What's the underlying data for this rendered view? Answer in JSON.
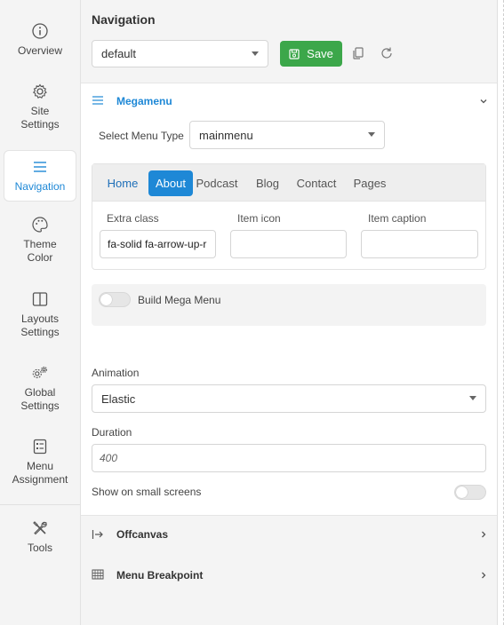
{
  "sidebar": {
    "items": [
      {
        "label": "Overview",
        "icon": "info-circle-icon"
      },
      {
        "label": "Site Settings",
        "icon": "gear-icon"
      },
      {
        "label": "Navigation",
        "icon": "hamburger-menu-icon",
        "active": true
      },
      {
        "label": "Theme Color",
        "icon": "palette-icon"
      },
      {
        "label": "Layouts Settings",
        "icon": "layout-columns-icon"
      },
      {
        "label": "Global Settings",
        "icon": "gears-icon"
      },
      {
        "label": "Menu Assignment",
        "icon": "list-document-icon"
      },
      {
        "label": "Tools",
        "icon": "tools-icon"
      }
    ]
  },
  "header": {
    "title": "Navigation",
    "preset_value": "default",
    "save_label": "Save"
  },
  "megamenu": {
    "title": "Megamenu",
    "menu_type_label": "Select Menu Type",
    "menu_type_value": "mainmenu",
    "tabs": [
      "Home",
      "About",
      "Podcast",
      "Blog",
      "Contact",
      "Pages"
    ],
    "active_tab": "About",
    "fields": {
      "extra_class_label": "Extra class",
      "extra_class_value": "fa-solid fa-arrow-up-r",
      "item_icon_label": "Item icon",
      "item_icon_value": "",
      "item_caption_label": "Item caption",
      "item_caption_value": ""
    },
    "build_mega_menu_label": "Build Mega Menu",
    "build_mega_menu_on": false,
    "animation_label": "Animation",
    "animation_value": "Elastic",
    "duration_label": "Duration",
    "duration_placeholder": "400",
    "small_screens_label": "Show on small screens",
    "small_screens_on": false
  },
  "sections": [
    {
      "title": "Offcanvas",
      "icon": "arrow-right-bar-icon"
    },
    {
      "title": "Menu Breakpoint",
      "icon": "breakpoint-grid-icon"
    }
  ],
  "colors": {
    "accent": "#1e88d6",
    "save": "#3ca74a"
  }
}
